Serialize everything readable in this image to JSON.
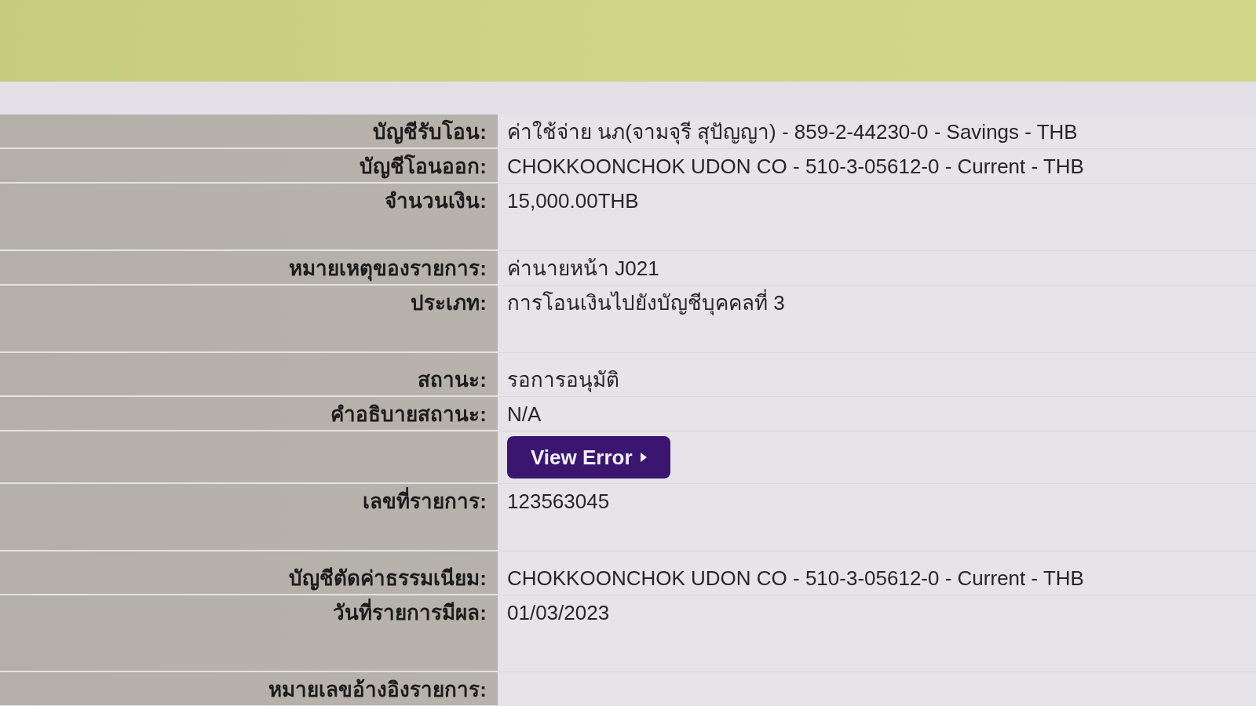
{
  "details": {
    "rows": [
      {
        "kind": "text",
        "label": "บัญชีรับโอน:",
        "value": "ค่าใช้จ่าย นภ(จามจุรี สุปัญญา) - 859-2-44230-0 - Savings - THB"
      },
      {
        "kind": "text",
        "label": "บัญชีโอนออก:",
        "value": "CHOKKOONCHOK UDON CO - 510-3-05612-0 - Current - THB"
      },
      {
        "kind": "text",
        "label": "จำนวนเงิน:",
        "value": "15,000.00THB"
      },
      {
        "kind": "text",
        "label": "หมายเหตุของรายการ:",
        "value": "ค่านายหน้า J021"
      },
      {
        "kind": "text",
        "label": "ประเภท:",
        "value": "การโอนเงินไปยังบัญชีบุคคลที่ 3"
      },
      {
        "kind": "text",
        "label": "สถานะ:",
        "value": "รอการอนุมัติ"
      },
      {
        "kind": "text",
        "label": "คำอธิบายสถานะ:",
        "value": "N/A"
      },
      {
        "kind": "button",
        "button": "View Error"
      },
      {
        "kind": "text",
        "label": "เลขที่รายการ:",
        "value": "123563045"
      },
      {
        "kind": "text",
        "label": "บัญชีตัดค่าธรรมเนียม:",
        "value": "CHOKKOONCHOK UDON CO - 510-3-05612-0 - Current - THB"
      },
      {
        "kind": "text",
        "label": "วันที่รายการมีผล:",
        "value": "01/03/2023"
      },
      {
        "kind": "text",
        "label": "หมายเลขอ้างอิงรายการ:"
      }
    ]
  }
}
